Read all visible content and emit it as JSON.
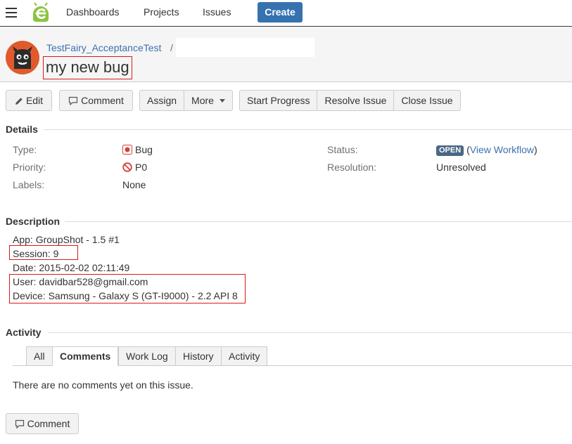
{
  "nav": {
    "menu_icon": "hamburger-menu-icon",
    "logo_icon": "green-bug-logo",
    "dashboards": "Dashboards",
    "projects": "Projects",
    "issues": "Issues",
    "create": "Create"
  },
  "header": {
    "project": "TestFairy_AcceptanceTest",
    "separator": "/",
    "summary": "my new bug"
  },
  "toolbar": {
    "edit": "Edit",
    "comment": "Comment",
    "assign": "Assign",
    "more": "More",
    "start_progress": "Start Progress",
    "resolve_issue": "Resolve Issue",
    "close_issue": "Close Issue"
  },
  "details": {
    "title": "Details",
    "type_label": "Type:",
    "type_value": "Bug",
    "priority_label": "Priority:",
    "priority_value": "P0",
    "labels_label": "Labels:",
    "labels_value": "None",
    "status_label": "Status:",
    "status_value": "OPEN",
    "view_workflow": "View Workflow",
    "resolution_label": "Resolution:",
    "resolution_value": "Unresolved"
  },
  "description": {
    "title": "Description",
    "app": "App: GroupShot - 1.5 #1",
    "session": "Session: 9",
    "date": "Date: 2015-02-02 02:11:49",
    "user": "User: davidbar528@gmail.com",
    "device": "Device: Samsung - Galaxy S (GT-I9000) - 2.2 API 8"
  },
  "activity": {
    "title": "Activity",
    "tabs": [
      "All",
      "Comments",
      "Work Log",
      "History",
      "Activity"
    ],
    "active_tab": "Comments",
    "empty_message": "There are no comments yet on this issue.",
    "comment_button": "Comment"
  },
  "colors": {
    "accent": "#3572b0",
    "highlight_box": "#d81b1b",
    "status_lozenge": "#4a6785"
  }
}
